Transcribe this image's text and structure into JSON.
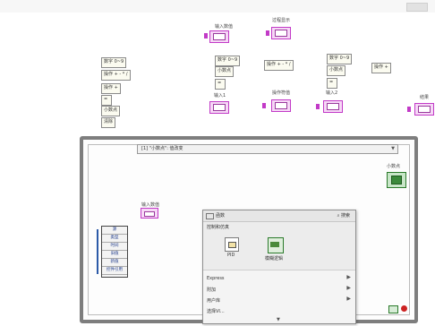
{
  "labels": {
    "input_num": "输入数值",
    "display_str": "过程显示",
    "digit1": "数字 0~9",
    "digit2": "数字 0~9",
    "op1": "操作 + - * /",
    "op2": "操作 + - * /",
    "op_plus": "操作 +",
    "decimal1": "小数点",
    "decimal2": "小数点",
    "equal1": "=",
    "equal2": "=",
    "equal_box": "=",
    "clear": "清除",
    "input1": "输入1",
    "op_value": "操作符值",
    "input2": "输入2",
    "result": "结果",
    "input_num_inner": "输入数值"
  },
  "loop": {
    "selector": "[1] \"小数点\": 值改变",
    "decimal_label": "小数点"
  },
  "cluster": {
    "items": [
      "源",
      "类型",
      "时间",
      "旧值",
      "新值",
      "控件引用"
    ]
  },
  "palette": {
    "title": "函数",
    "search": "搜索",
    "category": "控制和仿真",
    "icons": [
      {
        "label": "PID"
      },
      {
        "label": "模糊逻辑"
      }
    ],
    "lower_rows": [
      "Express",
      "附加",
      "用户库",
      "选择VI..."
    ]
  },
  "colors": {
    "string_wire": "#c23ac7",
    "cluster_wire": "#2c5aa8",
    "boolean_term": "#2a7a2a",
    "loop_border": "#7e7e7e"
  }
}
